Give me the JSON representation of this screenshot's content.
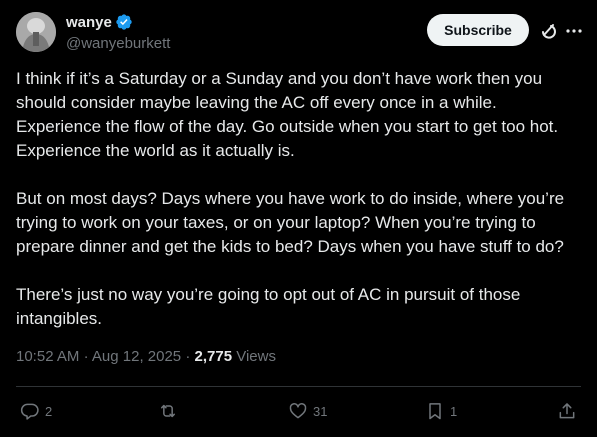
{
  "author": {
    "display_name": "wanye",
    "handle": "@wanyeburkett",
    "verified": true,
    "verified_color": "#1d9bf0"
  },
  "header": {
    "subscribe_label": "Subscribe",
    "icons": [
      "grok-icon",
      "more-icon"
    ]
  },
  "post": {
    "paragraphs": [
      "I think if it’s a Saturday or a Sunday and you don’t have work then you should consider maybe leaving the AC off every once in a while. Experience the flow of the day. Go outside when you start to get too hot. Experience the world as it actually is.",
      "But on most days? Days where you have work to do inside, where you’re trying to work on your taxes, or on your laptop? When you’re trying to prepare dinner and get the kids to bed? Days when you have stuff to do?",
      "There’s just no way you’re going to opt out of AC in pursuit of those intangibles."
    ],
    "time": "10:52 AM",
    "separator": "·",
    "date": "Aug 12, 2025",
    "views_count": "2,775",
    "views_label": "Views"
  },
  "actions": {
    "replies": "2",
    "reposts": "",
    "likes": "31",
    "bookmarks": "1",
    "icons": [
      "reply-icon",
      "repost-icon",
      "like-icon",
      "bookmark-icon",
      "share-icon"
    ]
  },
  "colors": {
    "background": "#000000",
    "text": "#e7e9ea",
    "muted": "#71767b",
    "button_bg": "#eff3f4",
    "divider": "#2f3336"
  }
}
